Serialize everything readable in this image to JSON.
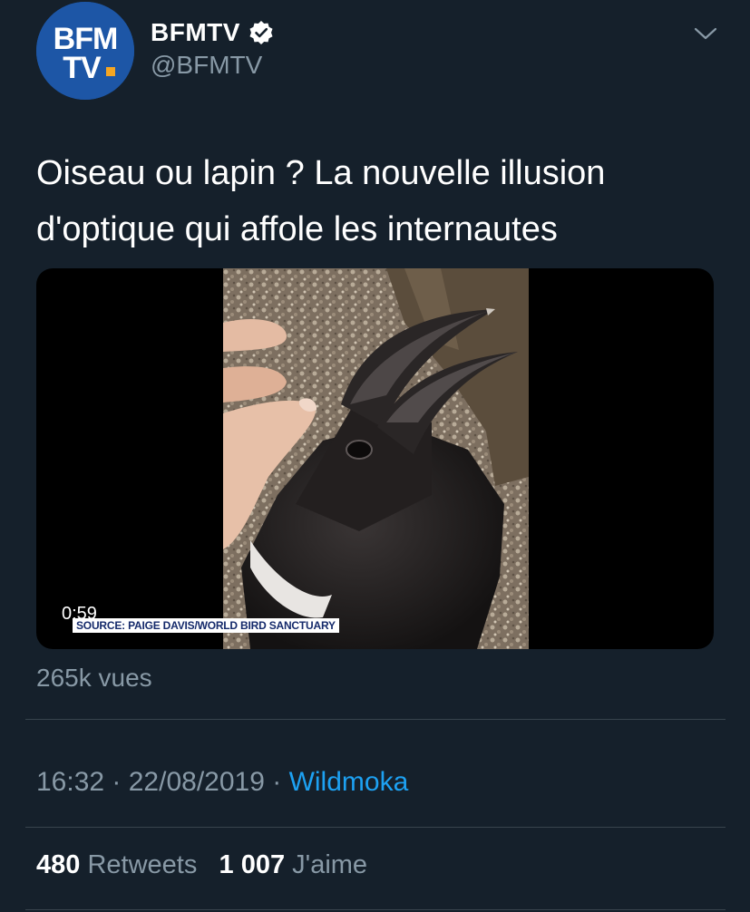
{
  "tweet": {
    "author": {
      "display_name": "BFMTV",
      "handle": "@BFMTV",
      "logo_text_top": "BFM",
      "logo_text_bottom": "TV.",
      "brand_color": "#1d56a6",
      "accent_color": "#f5a623"
    },
    "text": "Oiseau ou lapin ? La nouvelle illusion d'optique qui affole les internautes",
    "media": {
      "duration": "0:59",
      "source_caption": "SOURCE: PAIGE DAVIS/WORLD BIRD SANCTUARY"
    },
    "views": "265k vues",
    "time": "16:32",
    "date": "22/08/2019",
    "app": "Wildmoka",
    "retweets_count": "480",
    "retweets_label": "Retweets",
    "likes_count": "1 007",
    "likes_label": "J'aime"
  },
  "icons": {
    "verified": "verified-badge-icon",
    "menu": "chevron-down-icon"
  },
  "colors": {
    "background": "#15202b",
    "secondary_text": "#8899a6",
    "link": "#1da1f2",
    "divider": "#38444d"
  }
}
